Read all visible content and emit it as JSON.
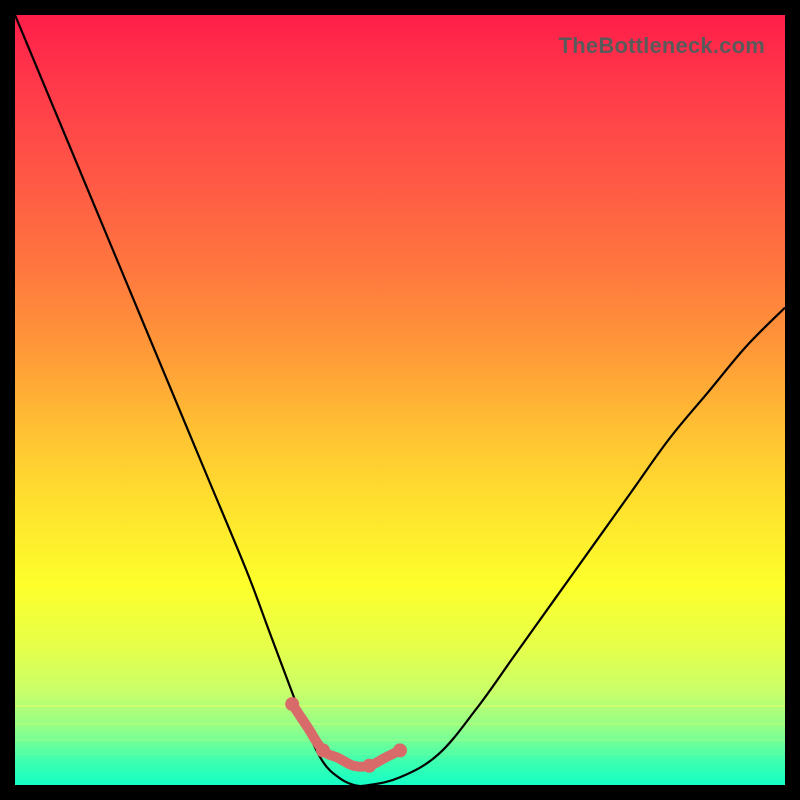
{
  "watermark": "TheBottleneck.com",
  "colors": {
    "black": "#000000",
    "curve": "#000000",
    "highlight": "#d86a6a",
    "gradient_top": "#ff1e4a",
    "gradient_mid": "#fdff2b",
    "gradient_bottom": "#14ffc6"
  },
  "chart_data": {
    "type": "line",
    "title": "",
    "xlabel": "",
    "ylabel": "",
    "xlim": [
      0,
      100
    ],
    "ylim": [
      0,
      100
    ],
    "grid": false,
    "legend": false,
    "annotations": [],
    "series": [
      {
        "name": "bottleneck-curve",
        "x": [
          0,
          5,
          10,
          15,
          20,
          25,
          30,
          33,
          36,
          38,
          40,
          42,
          44,
          46,
          50,
          55,
          60,
          65,
          70,
          75,
          80,
          85,
          90,
          95,
          100
        ],
        "values": [
          100,
          88,
          76,
          64,
          52,
          40,
          28,
          20,
          12,
          7,
          3,
          1,
          0,
          0,
          1,
          4,
          10,
          17,
          24,
          31,
          38,
          45,
          51,
          57,
          62
        ]
      },
      {
        "name": "optimal-range-highlight",
        "x": [
          36,
          38,
          40,
          42,
          44,
          46,
          48,
          50
        ],
        "values": [
          8,
          5,
          2,
          1,
          0,
          0,
          1,
          2
        ]
      }
    ]
  }
}
